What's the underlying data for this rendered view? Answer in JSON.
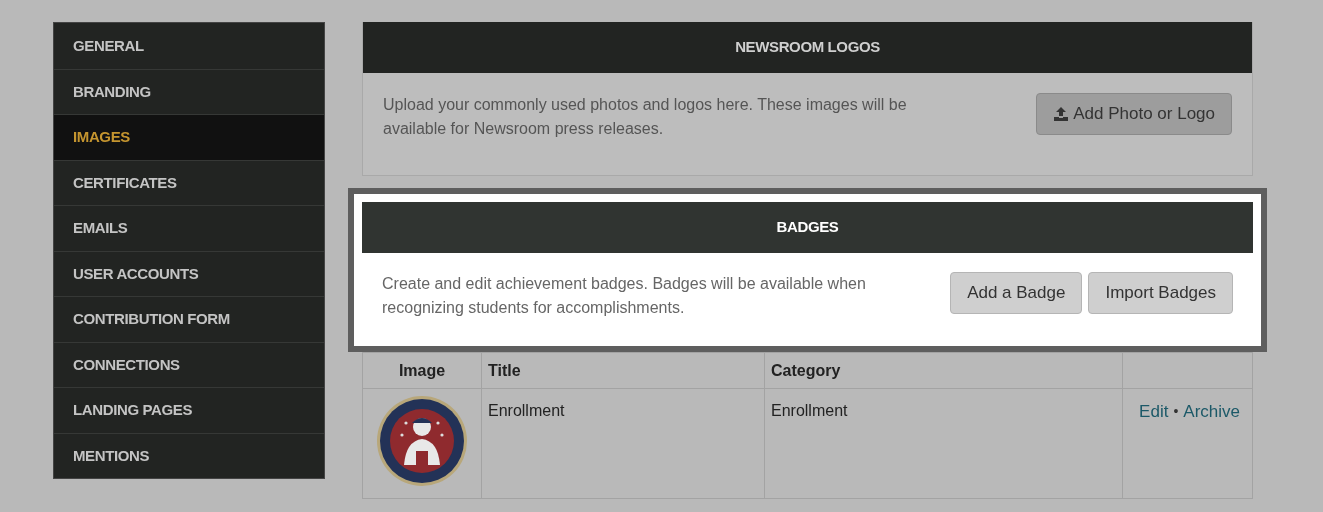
{
  "sidebar": {
    "items": [
      {
        "label": "GENERAL",
        "selected": false
      },
      {
        "label": "BRANDING",
        "selected": false
      },
      {
        "label": "IMAGES",
        "selected": true
      },
      {
        "label": "CERTIFICATES",
        "selected": false
      },
      {
        "label": "EMAILS",
        "selected": false
      },
      {
        "label": "USER ACCOUNTS",
        "selected": false
      },
      {
        "label": "CONTRIBUTION FORM",
        "selected": false
      },
      {
        "label": "CONNECTIONS",
        "selected": false
      },
      {
        "label": "LANDING PAGES",
        "selected": false
      },
      {
        "label": "MENTIONS",
        "selected": false
      }
    ]
  },
  "panels": [
    {
      "title": "NEWSROOM LOGOS",
      "highlighted": false,
      "description": "Upload your commonly used photos and logos here. These images will be available for Newsroom press releases.",
      "buttons": [
        {
          "label": "Add Photo or Logo",
          "kind": "upload"
        }
      ]
    },
    {
      "title": "BADGES",
      "highlighted": true,
      "description": "Create and edit achievement badges. Badges will be available when recognizing students for accomplishments.",
      "buttons": [
        {
          "label": "Add a Badge"
        },
        {
          "label": "Import Badges"
        }
      ]
    }
  ],
  "table": {
    "columns": [
      "Image",
      "Title",
      "Category"
    ],
    "rows": [
      {
        "image": {
          "kind": "picture"
        },
        "title": "Enrollment",
        "category": "Enrollment",
        "actions": [
          "Edit",
          "Archive"
        ],
        "separator": "•"
      }
    ]
  }
}
